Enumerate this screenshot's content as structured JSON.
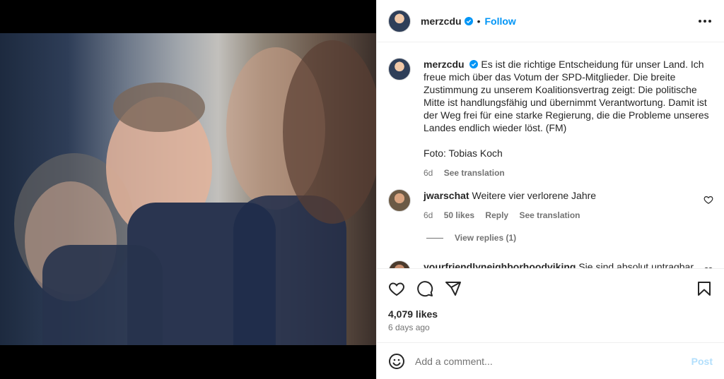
{
  "post": {
    "username": "merzcdu",
    "follow_label": "Follow",
    "dot": "•",
    "caption": "Es ist die richtige Entscheidung für unser Land. Ich freue mich über das Votum der SPD-Mitglieder. Die breite Zustimmung zu unserem Koalitionsvertrag zeigt: Die politische Mitte ist handlungsfähig und übernimmt Verantwortung. Damit ist der Weg frei für eine starke Regierung, die die Probleme unseres Landes endlich wieder löst. (FM)",
    "credit": "Foto: Tobias Koch",
    "age": "6d",
    "see_translation": "See translation",
    "likes": "4,079 likes",
    "posted_ago": "6 days ago"
  },
  "comments": [
    {
      "username": "jwarschat",
      "text": "Weitere vier verlorene Jahre",
      "age": "6d",
      "likes": "50 likes",
      "reply": "Reply",
      "see_translation": "See translation",
      "view_replies": "View replies (1)"
    },
    {
      "username": "yourfriendlyneighborhoodviking",
      "text": "Sie sind absolut untragbar"
    }
  ],
  "composer": {
    "placeholder": "Add a comment...",
    "post_label": "Post"
  },
  "colors": {
    "accent": "#0095f6",
    "verified": "#0095f6",
    "post_disabled": "#b2dffc"
  },
  "icons": [
    "more-icon",
    "verified-icon",
    "heart-icon",
    "comment-icon",
    "share-icon",
    "bookmark-icon",
    "emoji-icon"
  ]
}
